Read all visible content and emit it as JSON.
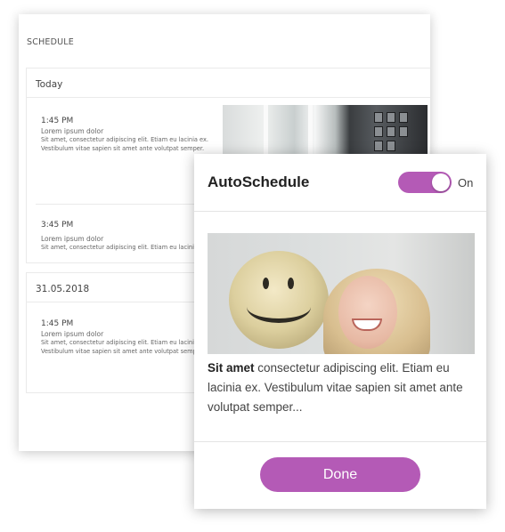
{
  "schedule": {
    "title": "SCHEDULE",
    "sections": [
      {
        "header": "Today",
        "entries": [
          {
            "time": "1:45 PM",
            "subtitle": "Lorem ipsum dolor",
            "line1": "Sit amet, consectetur adipiscing elit. Etiam eu lacinia ex.",
            "line2": "Vestibulum vitae sapien sit amet ante volutpat semper."
          },
          {
            "time": "3:45 PM",
            "subtitle": "Lorem ipsum dolor",
            "line1": "Sit amet, consectetur adipiscing elit. Etiam eu lacinia ex. V"
          }
        ]
      },
      {
        "header": "31.05.2018",
        "entries": [
          {
            "time": "1:45 PM",
            "subtitle": "Lorem ipsum dolor",
            "line1": "Sit amet, consectetur adipiscing elit. Etiam eu lacinia ex.",
            "line2": "Vestibulum vitae sapien sit amet ante volutpat semper."
          }
        ]
      }
    ]
  },
  "auto_schedule": {
    "title": "AutoSchedule",
    "toggle": {
      "state": "On",
      "checked": true,
      "color": "#b45ab6"
    },
    "body_bold": "Sit amet",
    "body_rest": " consectetur adipiscing elit. Etiam eu lacinia ex. Vestibulum vitae sapien sit amet ante volutpat semper...",
    "done_label": "Done",
    "accent_color": "#b45ab6"
  }
}
